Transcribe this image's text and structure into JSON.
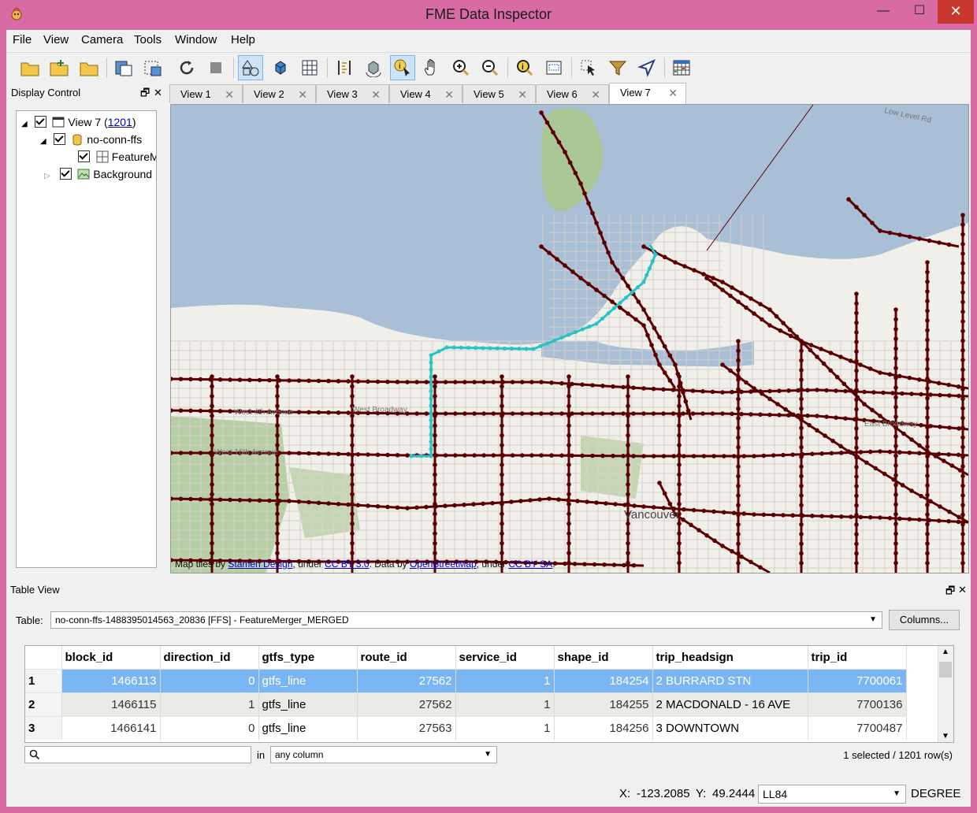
{
  "window": {
    "title": "FME Data Inspector",
    "controls": {
      "minimize": "—",
      "maximize": "☐",
      "close": "✕"
    }
  },
  "menu": [
    "File",
    "View",
    "Camera",
    "Tools",
    "Window",
    "Help"
  ],
  "toolbar_icons": [
    "open-folder-icon",
    "add-dataset-icon",
    "folder-icon",
    "save-copy-icon",
    "save-selection-icon",
    "refresh-icon",
    "stop-icon",
    "2d-view-icon",
    "3d-view-icon",
    "table-grid-icon",
    "measure-icon",
    "orbit-icon",
    "inspect-select-icon",
    "pan-hand-icon",
    "zoom-in-icon",
    "zoom-out-icon",
    "zoom-extents-icon",
    "zoom-box-icon",
    "select-icon",
    "filter-icon",
    "navigate-icon",
    "color-grid-icon"
  ],
  "display_control": {
    "title": "Display Control",
    "float_btn": "🗗",
    "close_btn": "✕",
    "tree": {
      "view_label": "View 7 (",
      "view_count": "1201",
      "view_suffix": ")",
      "dataset": "no-conn-ffs",
      "feature": "FeatureM",
      "background": "Background"
    }
  },
  "tabs": [
    {
      "label": "View 1"
    },
    {
      "label": "View 2"
    },
    {
      "label": "View 3"
    },
    {
      "label": "View 4"
    },
    {
      "label": "View 5"
    },
    {
      "label": "View 6"
    },
    {
      "label": "View 7",
      "active": true
    }
  ],
  "tab_close": "✕",
  "map": {
    "place_label": "Vancouver",
    "street_labels": [
      "West 4th Avenue",
      "West Broadway",
      "West 16th Avenue",
      "East Broadway",
      "Low Level Rd"
    ],
    "attribution": {
      "t1": "Map tiles by ",
      "l1": "Stamen Design",
      "t2": ", under ",
      "l2": "CC BY 3.0",
      "t3": ". Data by ",
      "l3": "OpenStreetMap",
      "t4": ", under ",
      "l4": "CC BY SA",
      "t5": "."
    },
    "colors": {
      "water": "#a8bfd6",
      "land": "#f1efea",
      "park": "#a9c896",
      "routes": "#5b0000",
      "selected_route": "#28c3c6"
    }
  },
  "table_view": {
    "title": "Table View",
    "table_label": "Table:",
    "table_value": "no-conn-ffs-1488395014563_20836 [FFS] - FeatureMerger_MERGED",
    "columns_btn": "Columns...",
    "headers": [
      "block_id",
      "direction_id",
      "gtfs_type",
      "route_id",
      "service_id",
      "shape_id",
      "trip_headsign",
      "trip_id"
    ],
    "rows": [
      {
        "n": "1",
        "cells": [
          "1466113",
          "0",
          "gtfs_line",
          "27562",
          "1",
          "184254",
          "2 BURRARD STN",
          "7700061"
        ]
      },
      {
        "n": "2",
        "cells": [
          "1466115",
          "1",
          "gtfs_line",
          "27562",
          "1",
          "184255",
          "2 MACDONALD - 16 AVE",
          "7700136"
        ]
      },
      {
        "n": "3",
        "cells": [
          "1466141",
          "0",
          "gtfs_line",
          "27563",
          "1",
          "184256",
          "3 DOWNTOWN",
          "7700487"
        ]
      }
    ],
    "search_in": "in",
    "search_scope": "any column",
    "selection_status": "1 selected / 1201 row(s)"
  },
  "statusbar": {
    "x_label": "X:",
    "x_value": "-123.2085",
    "y_label": "Y:",
    "y_value": "49.2444",
    "crs": "LL84",
    "units": "DEGREE"
  }
}
